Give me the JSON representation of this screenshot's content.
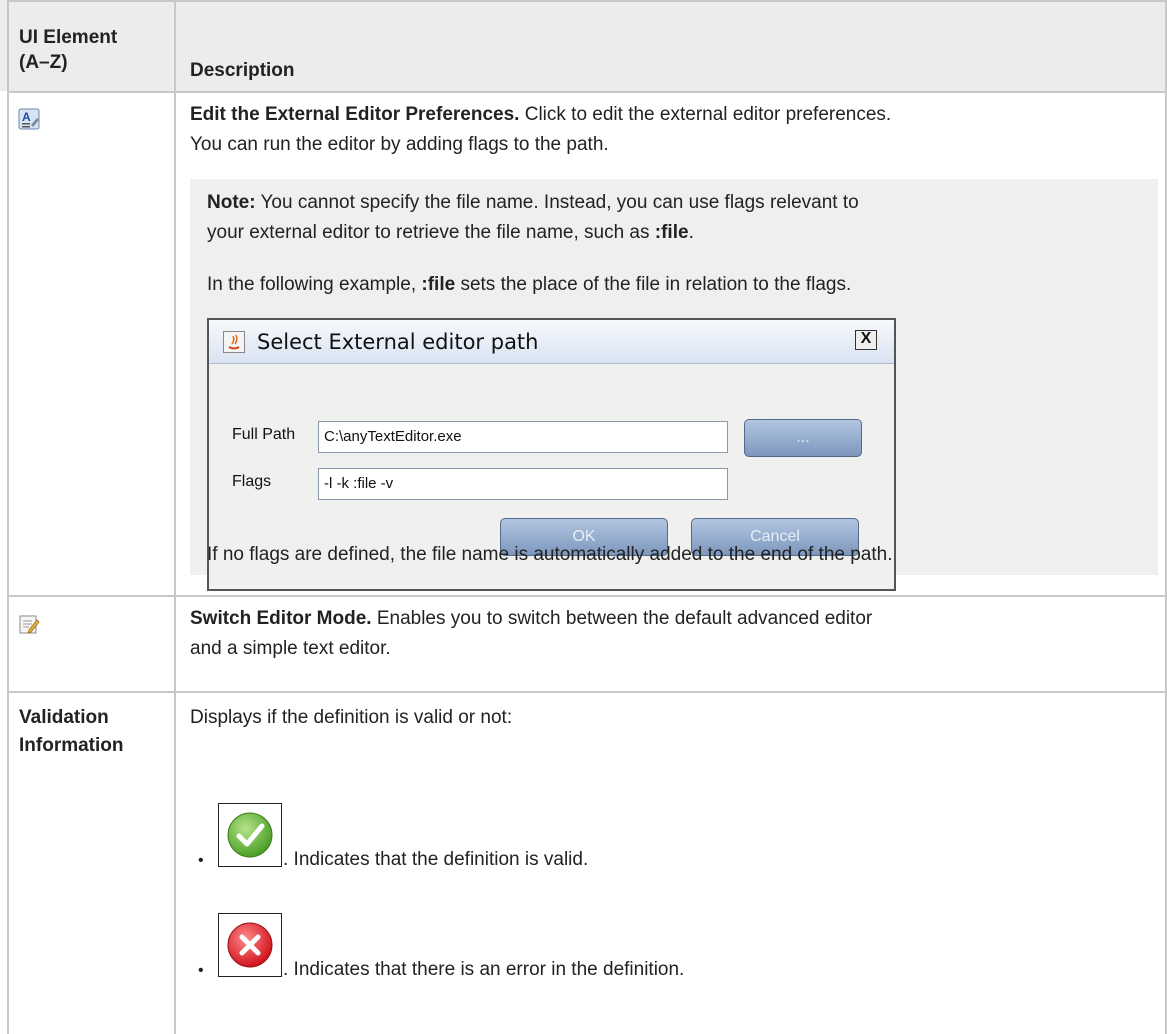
{
  "header": {
    "col1": "UI Element (A–Z)",
    "col1_line1": "UI Element",
    "col1_line2": "(A–Z)",
    "col2": "Description"
  },
  "row_edit": {
    "icon": "edit-preferences-icon",
    "title": "Edit the External Editor Preferences.",
    "text_line1": " Click to edit the external editor preferences.",
    "text_line2": "You can run the editor by adding flags to the path.",
    "note_label": "Note:",
    "note_line1": " You cannot specify the file name. Instead, you can use flags relevant to",
    "note_line2a": "your external editor to retrieve the file name, such as ",
    "note_flag": ":file",
    "note_line2b": ".",
    "example_a": "In the following example, ",
    "example_flag": ":file",
    "example_b": " sets the place of the file in relation to the flags.",
    "after_text": "If no flags are defined, the file name is automatically added to the end of the path."
  },
  "dialog": {
    "title": "Select External editor path",
    "close_label": "X",
    "full_path_label": "Full Path",
    "full_path_value": "C:\\anyTextEditor.exe",
    "browse_label": "...",
    "flags_label": "Flags",
    "flags_value": "-l -k :file -v",
    "ok_label": "OK",
    "cancel_label": "Cancel"
  },
  "row_switch": {
    "icon": "switch-editor-mode-icon",
    "title": "Switch Editor Mode.",
    "text_line1": " Enables you to switch between the default advanced editor",
    "text_line2": "and a simple text editor."
  },
  "row_validation": {
    "label_line1": "Validation",
    "label_line2": "Information",
    "intro": "Displays if the definition is valid or not:",
    "valid_text": ". Indicates that the definition is valid.",
    "error_text": ". Indicates that there is an error in the definition.",
    "valid_icon": "green-check-icon",
    "error_icon": "red-x-icon"
  },
  "colors": {
    "border": "#c8c8c8",
    "header_bg": "#ececec",
    "note_bg": "#efefef",
    "valid_green": "#5cb030",
    "error_red": "#e0202a"
  }
}
